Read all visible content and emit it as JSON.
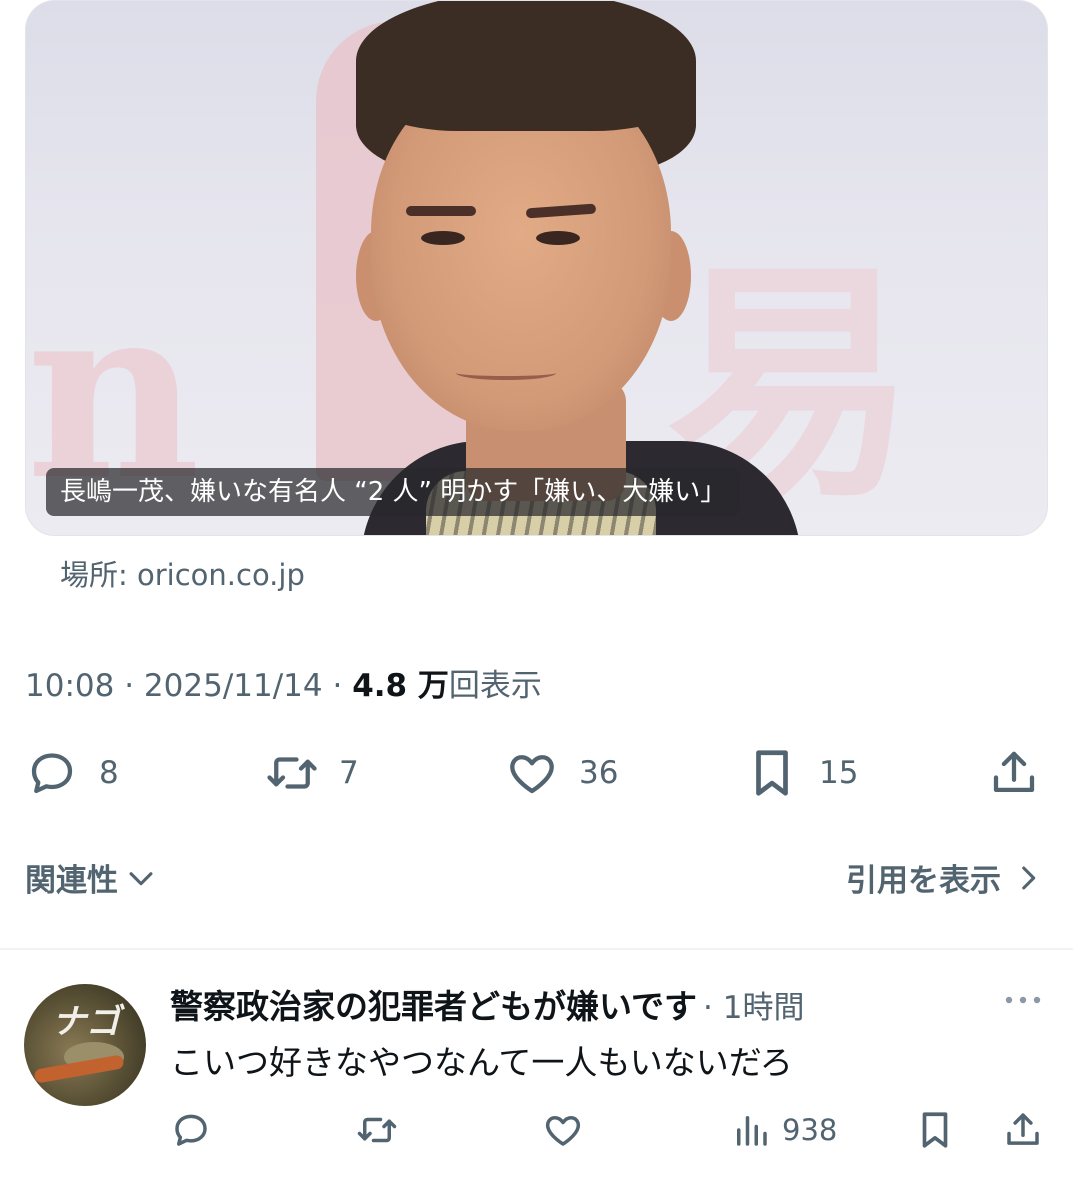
{
  "card": {
    "image_alt": "man in suit smiling",
    "caption": "長嶋一茂、嫌いな有名人 “2 人” 明かす「嫌い、大嫌い」",
    "source_label": "場所: oricon.co.jp"
  },
  "meta": {
    "time": "10:08",
    "separator": "·",
    "date": "2025/11/14",
    "views_count": "4.8 万",
    "views_label": "回表示"
  },
  "actions": {
    "reply_count": "8",
    "retweet_count": "7",
    "like_count": "36",
    "bookmark_count": "15",
    "icons": [
      "reply-icon",
      "retweet-icon",
      "heart-icon",
      "bookmark-icon",
      "share-icon"
    ]
  },
  "filters": {
    "sort_label": "関連性",
    "quotes_label": "引用を表示"
  },
  "reply": {
    "avatar_text": "ナゴ",
    "name": "警察政治家の犯罪者どもが嫌いです",
    "time": "· 1時間",
    "text": "こいつ好きなやつなんて一人もいないだろ",
    "views": "938"
  },
  "colors": {
    "text_primary": "#0f1419",
    "text_secondary": "#536471",
    "divider": "#eff3f4",
    "caption_bg": "rgba(40,40,44,0.72)"
  }
}
